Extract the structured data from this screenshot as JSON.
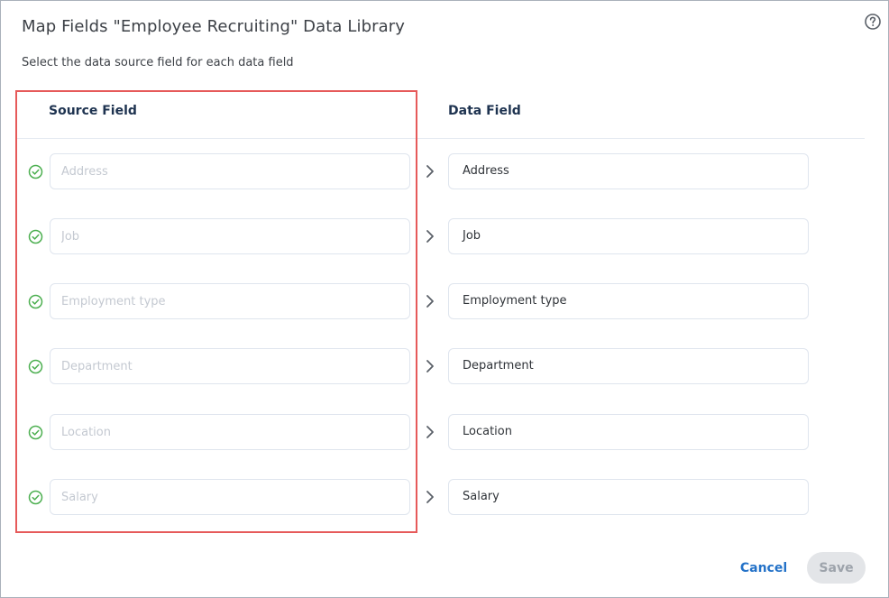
{
  "dialog": {
    "title": "Map Fields \"Employee Recruiting\" Data Library",
    "subtitle": "Select the data source field for each data field",
    "help_icon": "question-circle-icon"
  },
  "columns": {
    "source_header": "Source Field",
    "data_header": "Data Field"
  },
  "rows": [
    {
      "source_placeholder": "Address",
      "data_field": "Address",
      "mapped": true
    },
    {
      "source_placeholder": "Job",
      "data_field": "Job",
      "mapped": true
    },
    {
      "source_placeholder": "Employment type",
      "data_field": "Employment type",
      "mapped": true
    },
    {
      "source_placeholder": "Department",
      "data_field": "Department",
      "mapped": true
    },
    {
      "source_placeholder": "Location",
      "data_field": "Location",
      "mapped": true
    },
    {
      "source_placeholder": "Salary",
      "data_field": "Salary",
      "mapped": true
    }
  ],
  "footer": {
    "cancel_label": "Cancel",
    "save_label": "Save",
    "save_enabled": false
  },
  "colors": {
    "check": "#4caf50",
    "highlight": "#e65a5a",
    "cancel": "#2472c8",
    "save_disabled_bg": "#e3e5e8"
  }
}
